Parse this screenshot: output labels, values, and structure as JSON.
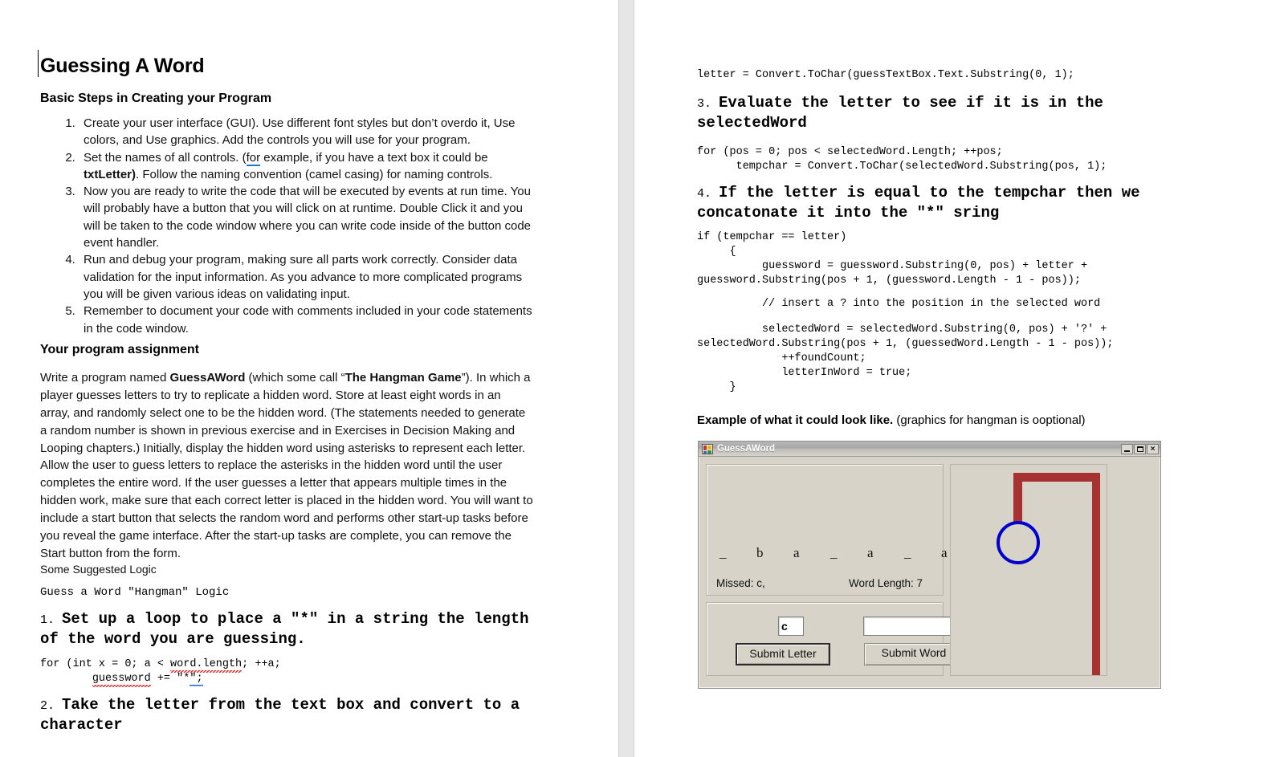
{
  "document": {
    "title": "Guessing A Word",
    "section1_heading": "Basic Steps in Creating your Program",
    "steps": [
      "Create your user interface (GUI). Use different font styles but don’t overdo it, Use colors, and Use graphics. Add the controls you will use for your program.",
      "Set the names of all controls. (for example, if you have a text box it could be txtLetter). Follow the naming convention (camel casing) for naming controls.",
      "Now you are ready to write the code that will be executed by events at run time. You will probably have a button that you will click on at runtime. Double Click it and you will be taken to the code window where you can write code inside of the button code event handler.",
      "Run and debug your program, making sure all parts work correctly. Consider data validation for the input information. As you advance to more complicated programs you will be given various ideas on validating input.",
      "Remember to document your code with comments included in your code statements in the code window."
    ],
    "step2_parts": {
      "a": "Set the names of all controls. (",
      "grammar": "for",
      "b": " example, if you have a text box it could be ",
      "bold": "txtLetter)",
      "c": ". Follow the naming convention (camel casing) for naming controls."
    },
    "section2_heading": "Your program assignment",
    "assignment_parts": {
      "p1": "Write a program named ",
      "b1": "GuessAWord",
      "p2": " (which some call “",
      "b2": "The Hangman Game",
      "p3": "”). In which a player guesses letters to try to replicate a hidden word. Store at least eight words in an array, and randomly select one to be the hidden word. (The statements needed to generate a random number is shown in previous exercise and in Exercises in Decision Making and Looping chapters.) Initially, display the hidden word using asterisks to represent each letter. Allow the user to guess letters to replace the asterisks in the hidden word until the user completes the entire word. If the user guesses a letter that appears multiple times in the hidden work, make sure that each correct letter is placed in the hidden word. You will want to include a start button that selects the random word and performs other start-up tasks before you reveal the game interface. After the start-up tasks are complete, you can remove the Start button from the form."
    },
    "suggested_logic_label": "Some Suggested Logic",
    "logic_title": "Guess a Word \"Hangman\" Logic",
    "step1_heading_num": "1. ",
    "step1_heading": "Set up a loop to place a \"*\" in a string the length of the word you are guessing.",
    "code1_line1": "for (int x = 0; a < ",
    "code1_word_length": "word.length",
    "code1_line1b": "; ++a;",
    "code1_line2_indent": "        ",
    "code1_guessword": "guessword",
    "code1_line2b": " += \"*",
    "code1_line2_tail": "\";",
    "step2_heading_num": "2. ",
    "step2_heading": "Take the letter from the text box and convert to a character",
    "code2_line": "letter = Convert.ToChar(guessTextBox.Text.Substring(0, 1);",
    "step3_heading_num": "3. ",
    "step3_heading": "Evaluate the letter to see if it is in the selectedWord",
    "code3_line1": "for (pos = 0; pos < selectedWord.Length; ++pos;",
    "code3_line2": "      tempchar = Convert.ToChar(selectedWord.Substring(pos, 1);",
    "step4_heading_num": "4. ",
    "step4_heading": "If the letter is equal to the tempchar then we concatonate it into the \"*\" sring",
    "code4_line1": "if (tempchar == letter)",
    "code4_line2": "     {",
    "code4_line3": "          guessword = guessword.Substring(0, pos) + letter +",
    "code4_line4": "guessword.Substring(pos + 1, (guessword.Length - 1 - pos));",
    "code4_comment": "          // insert a ? into the position in the selected word",
    "code4_line5": "          selectedWord = selectedWord.Substring(0, pos) + '?' +",
    "code4_line6": "selectedWord.Substring(pos + 1, (guessedWord.Length - 1 - pos));",
    "code4_line7": "             ++foundCount;",
    "code4_line8": "             letterInWord = true;",
    "code4_line9": "     }",
    "example_caption_bold": "Example of what it could look like.",
    "example_caption_reg": " (graphics for hangman is ooptional)"
  },
  "form": {
    "window_title": "GuessAWord",
    "icon_name": "vb-form-icon",
    "buttons": {
      "minimize": "–",
      "maximize": "□",
      "close": "×"
    },
    "word_letters": [
      "_",
      "b",
      "a",
      "_",
      "a",
      "_",
      "a"
    ],
    "missed_label": "Missed: c,",
    "word_length_label": "Word Length: 7",
    "letter_input_value": "c",
    "word_input_value": "",
    "submit_letter_label": "Submit Letter",
    "submit_word_label": "Submit Word"
  },
  "colors": {
    "gallows": "#A63232",
    "head": "#0000CC",
    "form_face": "#d7d3c9",
    "spellcheck": "#e03030",
    "grammarcheck": "#2b6fd4"
  }
}
